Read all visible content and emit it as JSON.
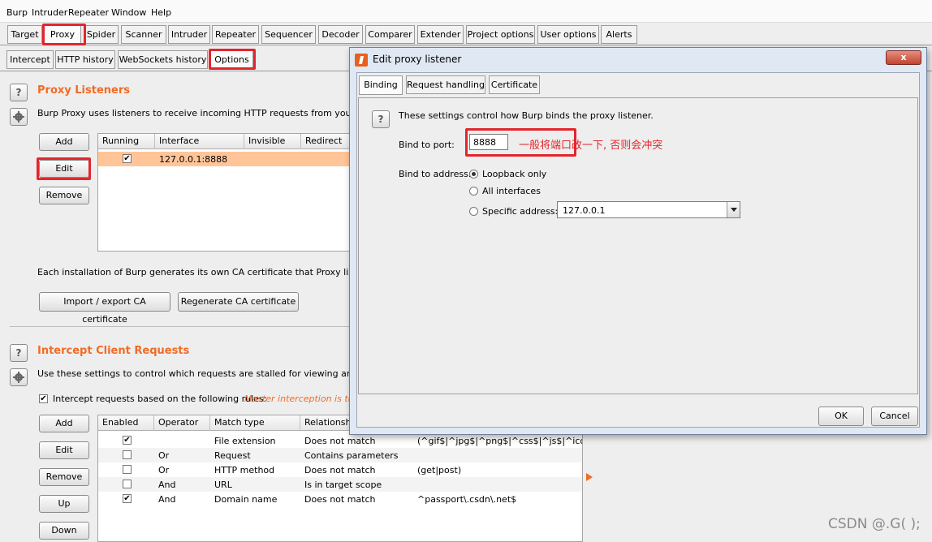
{
  "menu": [
    "Burp",
    "Intruder",
    "Repeater",
    "Window",
    "Help"
  ],
  "main_tabs": [
    "Target",
    "Proxy",
    "Spider",
    "Scanner",
    "Intruder",
    "Repeater",
    "Sequencer",
    "Decoder",
    "Comparer",
    "Extender",
    "Project options",
    "User options",
    "Alerts"
  ],
  "sub_tabs": [
    "Intercept",
    "HTTP history",
    "WebSockets history",
    "Options"
  ],
  "listeners": {
    "title": "Proxy Listeners",
    "desc": "Burp Proxy uses listeners to receive incoming HTTP requests from your browse",
    "buttons": {
      "add": "Add",
      "edit": "Edit",
      "remove": "Remove"
    },
    "columns": [
      "Running",
      "Interface",
      "Invisible",
      "Redirect"
    ],
    "rows": [
      {
        "running": true,
        "interface": "127.0.0.1:8888"
      }
    ],
    "ca_text": "Each installation of Burp generates its own CA certificate that Proxy listeners ca",
    "import_btn": "Import / export CA certificate",
    "regen_btn": "Regenerate CA certificate"
  },
  "intercept": {
    "title": "Intercept Client Requests",
    "desc": "Use these settings to control which requests are stalled for viewing and editing",
    "checkbox_label": "Intercept requests based on the following rules:",
    "master_note": "Master interception is turn",
    "buttons": {
      "add": "Add",
      "edit": "Edit",
      "remove": "Remove",
      "up": "Up",
      "down": "Down"
    },
    "columns": [
      "Enabled",
      "Operator",
      "Match type",
      "Relationship"
    ],
    "rows": [
      {
        "enabled": true,
        "operator": "",
        "match": "File extension",
        "rel": "Does not match",
        "cond": "(^gif$|^jpg$|^png$|^css$|^js$|^ico$)"
      },
      {
        "enabled": false,
        "operator": "Or",
        "match": "Request",
        "rel": "Contains parameters",
        "cond": ""
      },
      {
        "enabled": false,
        "operator": "Or",
        "match": "HTTP method",
        "rel": "Does not match",
        "cond": "(get|post)"
      },
      {
        "enabled": false,
        "operator": "And",
        "match": "URL",
        "rel": "Is in target scope",
        "cond": ""
      },
      {
        "enabled": true,
        "operator": "And",
        "match": "Domain name",
        "rel": "Does not match",
        "cond": "^passport\\.csdn\\.net$"
      }
    ]
  },
  "dialog": {
    "title": "Edit proxy listener",
    "tabs": [
      "Binding",
      "Request handling",
      "Certificate"
    ],
    "info": "These settings control how Burp binds the proxy listener.",
    "port_label": "Bind to port:",
    "port_value": "8888",
    "annotation": "一般将端口改一下, 否则会冲突",
    "address_label": "Bind to address:",
    "opt_loopback": "Loopback only",
    "opt_all": "All interfaces",
    "opt_specific": "Specific address:",
    "specific_value": "127.0.0.1",
    "ok": "OK",
    "cancel": "Cancel"
  },
  "watermark": "CSDN @.G( );",
  "colors": {
    "accent": "#f26b25",
    "highlight_row": "#ffc599",
    "annotation": "#e2262d"
  }
}
